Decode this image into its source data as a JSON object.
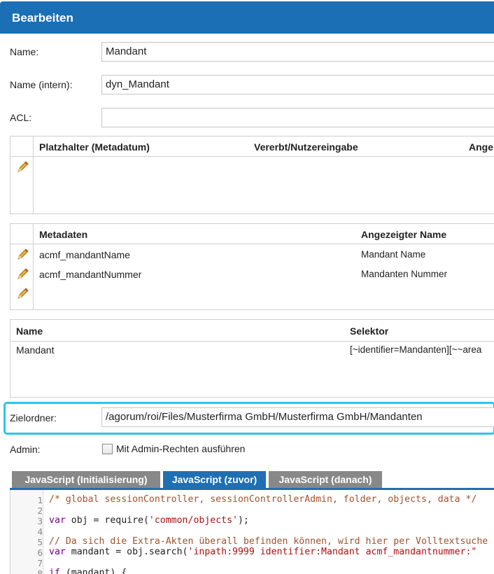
{
  "window": {
    "title": "Bearbeiten"
  },
  "form": {
    "name_label": "Name:",
    "name_value": "Mandant",
    "intern_label": "Name (intern):",
    "intern_value": "dyn_Mandant",
    "acl_label": "ACL:",
    "acl_value": "",
    "zielordner_label": "Zielordner:",
    "zielordner_value": "/agorum/roi/Files/Musterfirma GmbH/Musterfirma GmbH/Mandanten",
    "admin_label": "Admin:",
    "admin_checkbox_label": "Mit Admin-Rechten ausführen",
    "admin_checked": false
  },
  "placeholder_grid": {
    "headers": [
      "Platzhalter (Metadatum)",
      "Vererbt/Nutzereingabe",
      "Ange"
    ],
    "rows": []
  },
  "metadata_grid": {
    "headers": [
      "Metadaten",
      "Angezeigter Name"
    ],
    "rows": [
      {
        "meta": "acmf_mandantName",
        "display": "Mandant Name"
      },
      {
        "meta": "acmf_mandantNummer",
        "display": "Mandanten Nummer"
      }
    ]
  },
  "selector_grid": {
    "headers": [
      "Name",
      "Selektor"
    ],
    "rows": [
      {
        "name": "Mandant",
        "selector": "[~identifier=Mandanten][~~area"
      }
    ]
  },
  "tabs": [
    {
      "label": "JavaScript (Initialisierung)",
      "active": false
    },
    {
      "label": "JavaScript (zuvor)",
      "active": true
    },
    {
      "label": "JavaScript (danach)",
      "active": false
    }
  ],
  "colors": {
    "header_blue": "#1a6fb5",
    "highlight": "#2cc6e6",
    "tab_inactive": "#888888"
  },
  "icons": {
    "edit": "pencil-icon"
  },
  "editor": {
    "line_numbers": [
      "1",
      "2",
      "3",
      "4",
      "5",
      "6",
      "7",
      "8"
    ],
    "lines": {
      "l1": "/* global sessionController, sessionControllerAdmin, folder, objects, data */",
      "l3_kw": "var",
      "l3_a": " obj = require(",
      "l3_str": "'common/objects'",
      "l3_b": ");",
      "l5": "// Da sich die Extra-Akten überall befinden können, wird hier per Volltextsuche",
      "l6_kw": "var",
      "l6_a": " mandant = obj.search(",
      "l6_str": "'inpath:9999 identifier:Mandant acmf_mandantnummer:\"",
      "l8_kw": "if",
      "l8_a": " (mandant) {"
    }
  }
}
